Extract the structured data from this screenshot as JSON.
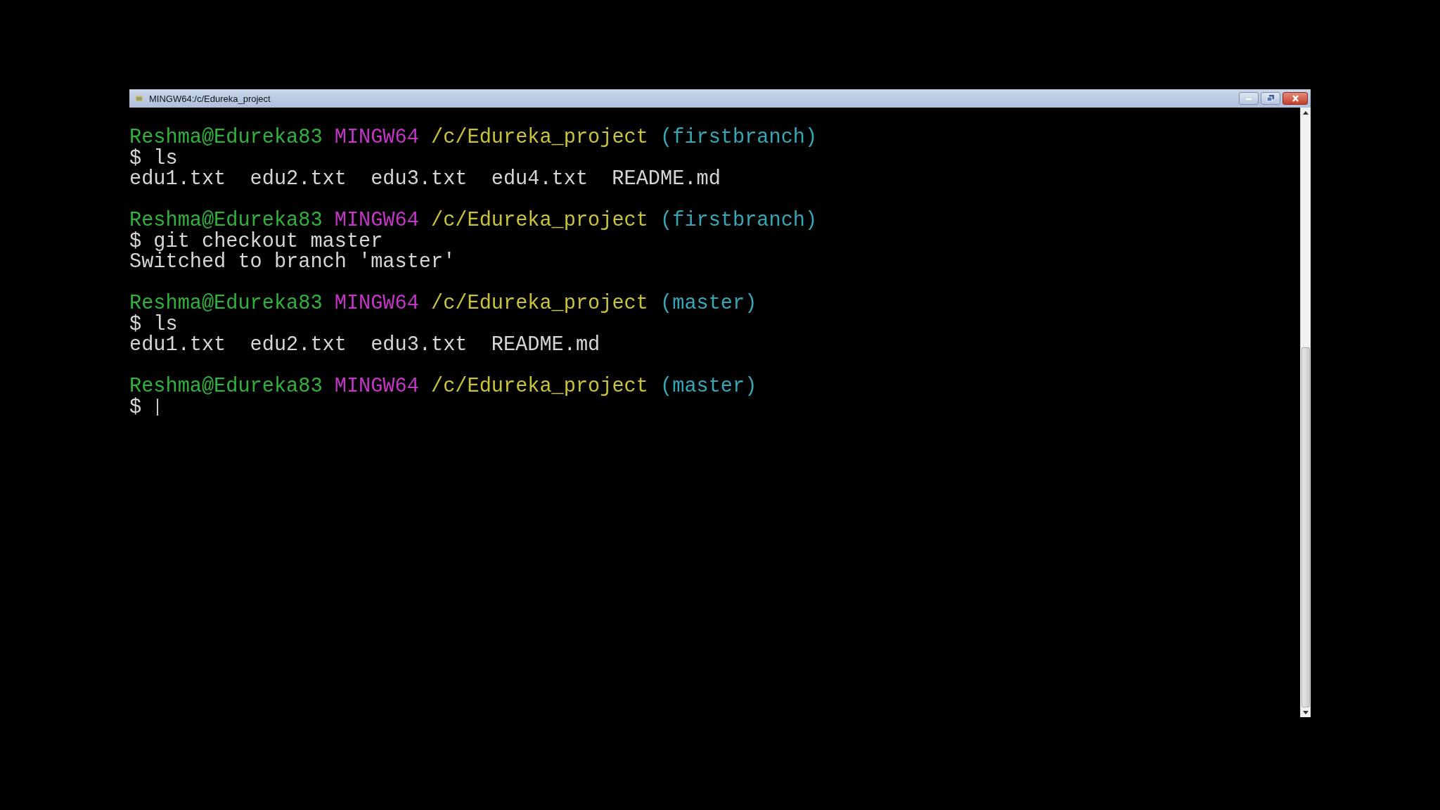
{
  "window": {
    "title": "MINGW64:/c/Edureka_project",
    "controls": [
      {
        "kind": "minimize"
      },
      {
        "kind": "restore"
      },
      {
        "kind": "close"
      }
    ]
  },
  "terminal": {
    "blocks": [
      {
        "prompt": {
          "user": "Reshma@Edureka83",
          "system": "MINGW64",
          "path": "/c/Edureka_project",
          "branch": "(firstbranch)"
        },
        "command": {
          "symbol": "$",
          "text": "ls"
        },
        "output": [
          "edu1.txt  edu2.txt  edu3.txt  edu4.txt  README.md"
        ]
      },
      {
        "prompt": {
          "user": "Reshma@Edureka83",
          "system": "MINGW64",
          "path": "/c/Edureka_project",
          "branch": "(firstbranch)"
        },
        "command": {
          "symbol": "$",
          "text": "git checkout master"
        },
        "output": [
          "Switched to branch 'master'"
        ]
      },
      {
        "prompt": {
          "user": "Reshma@Edureka83",
          "system": "MINGW64",
          "path": "/c/Edureka_project",
          "branch": "(master)"
        },
        "command": {
          "symbol": "$",
          "text": "ls"
        },
        "output": [
          "edu1.txt  edu2.txt  edu3.txt  README.md"
        ]
      },
      {
        "prompt": {
          "user": "Reshma@Edureka83",
          "system": "MINGW64",
          "path": "/c/Edureka_project",
          "branch": "(master)"
        },
        "command": {
          "symbol": "$",
          "cursor": true
        }
      }
    ]
  }
}
